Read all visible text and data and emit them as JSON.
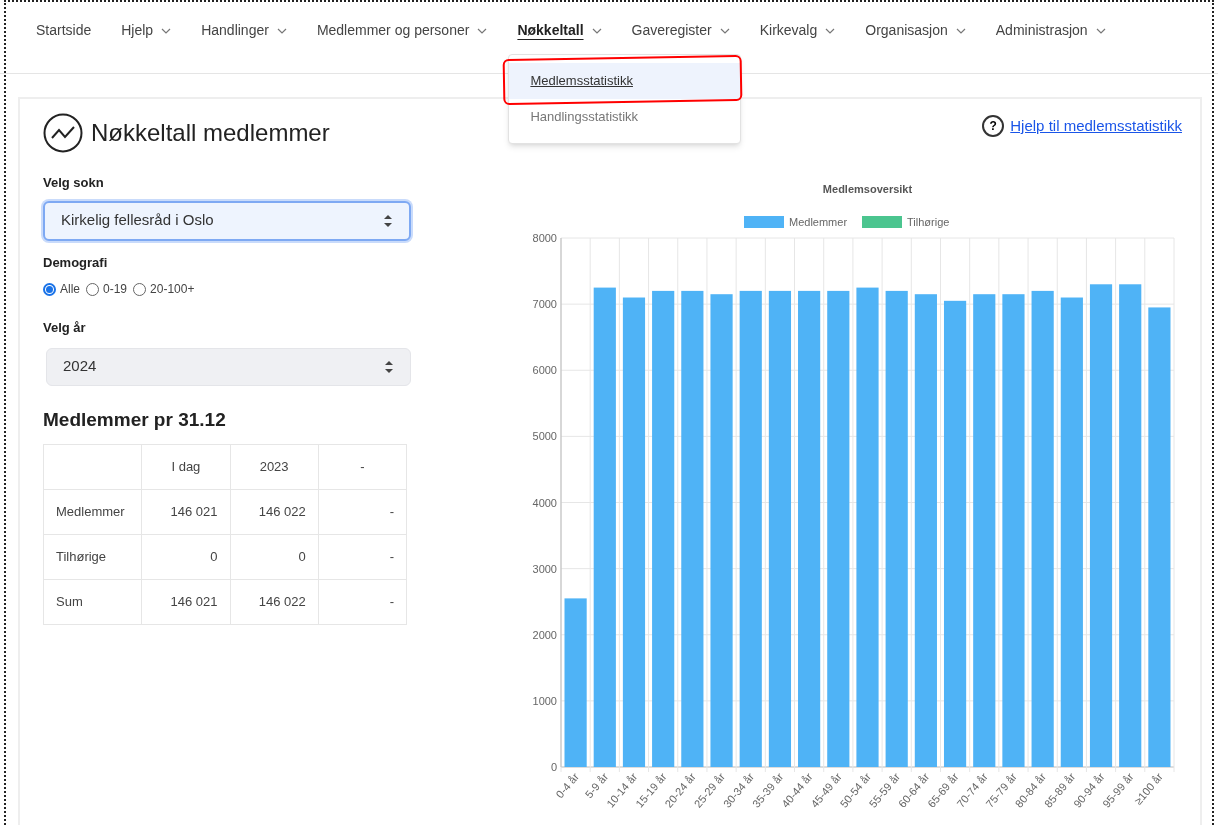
{
  "nav": [
    {
      "label": "Startside",
      "has_menu": false,
      "selected": false
    },
    {
      "label": "Hjelp",
      "has_menu": true,
      "selected": false
    },
    {
      "label": "Handlinger",
      "has_menu": true,
      "selected": false
    },
    {
      "label": "Medlemmer og personer",
      "has_menu": true,
      "selected": false
    },
    {
      "label": "Nøkkeltall",
      "has_menu": true,
      "selected": true
    },
    {
      "label": "Gaveregister",
      "has_menu": true,
      "selected": false
    },
    {
      "label": "Kirkevalg",
      "has_menu": true,
      "selected": false
    },
    {
      "label": "Organisasjon",
      "has_menu": true,
      "selected": false
    },
    {
      "label": "Administrasjon",
      "has_menu": true,
      "selected": false
    }
  ],
  "dropdown": [
    {
      "label": "Medlemsstatistikk",
      "selected": true
    },
    {
      "label": "Handlingsstatistikk",
      "selected": false
    }
  ],
  "page": {
    "title": "Nøkkeltall medlemmer",
    "help_icon": "?",
    "help_link": "Hjelp til medlemsstatistikk"
  },
  "sokn": {
    "label": "Velg sokn",
    "value": "Kirkelig fellesråd i Oslo",
    "focused": true
  },
  "demografi": {
    "label": "Demografi",
    "options": [
      {
        "label": "Alle",
        "selected": true
      },
      {
        "label": "0-19",
        "selected": false
      },
      {
        "label": "20-100+",
        "selected": false
      }
    ]
  },
  "year": {
    "label": "Velg år",
    "value": "2024",
    "focused": false
  },
  "table": {
    "title": "Medlemmer pr 31.12",
    "columns": [
      "",
      "I dag",
      "2023",
      "-"
    ],
    "rows": [
      [
        "Medlemmer",
        "146 021",
        "146 022",
        "-"
      ],
      [
        "Tilhørige",
        "0",
        "0",
        "-"
      ],
      [
        "Sum",
        "146 021",
        "146 022",
        "-"
      ]
    ]
  },
  "chart": {
    "chart_data": {
      "type": "bar",
      "title": "Medlemsoversikt",
      "categories": [
        "0-4 år",
        "5-9 år",
        "10-14 år",
        "15-19 år",
        "20-24 år",
        "25-29 år",
        "30-34 år",
        "35-39 år",
        "40-44 år",
        "45-49 år",
        "50-54 år",
        "55-59 år",
        "60-64 år",
        "65-69 år",
        "70-74 år",
        "75-79 år",
        "80-84 år",
        "85-89 år",
        "90-94 år",
        "95-99 år",
        "≥100 år"
      ],
      "series": [
        {
          "name": "Medlemmer",
          "color": "#4fb3f6",
          "values": [
            2550,
            7250,
            7100,
            7200,
            7200,
            7150,
            7200,
            7200,
            7200,
            7200,
            7250,
            7200,
            7150,
            7050,
            7150,
            7150,
            7200,
            7100,
            7300,
            7300,
            6950
          ]
        },
        {
          "name": "Tilhørige",
          "color": "#4bc58f",
          "values": [
            0,
            0,
            0,
            0,
            0,
            0,
            0,
            0,
            0,
            0,
            0,
            0,
            0,
            0,
            0,
            0,
            0,
            0,
            0,
            0,
            0
          ]
        }
      ],
      "grid": true,
      "ylim": [
        0,
        8000
      ],
      "yticks": [
        0,
        1000,
        2000,
        3000,
        4000,
        5000,
        6000,
        7000,
        8000
      ]
    }
  }
}
